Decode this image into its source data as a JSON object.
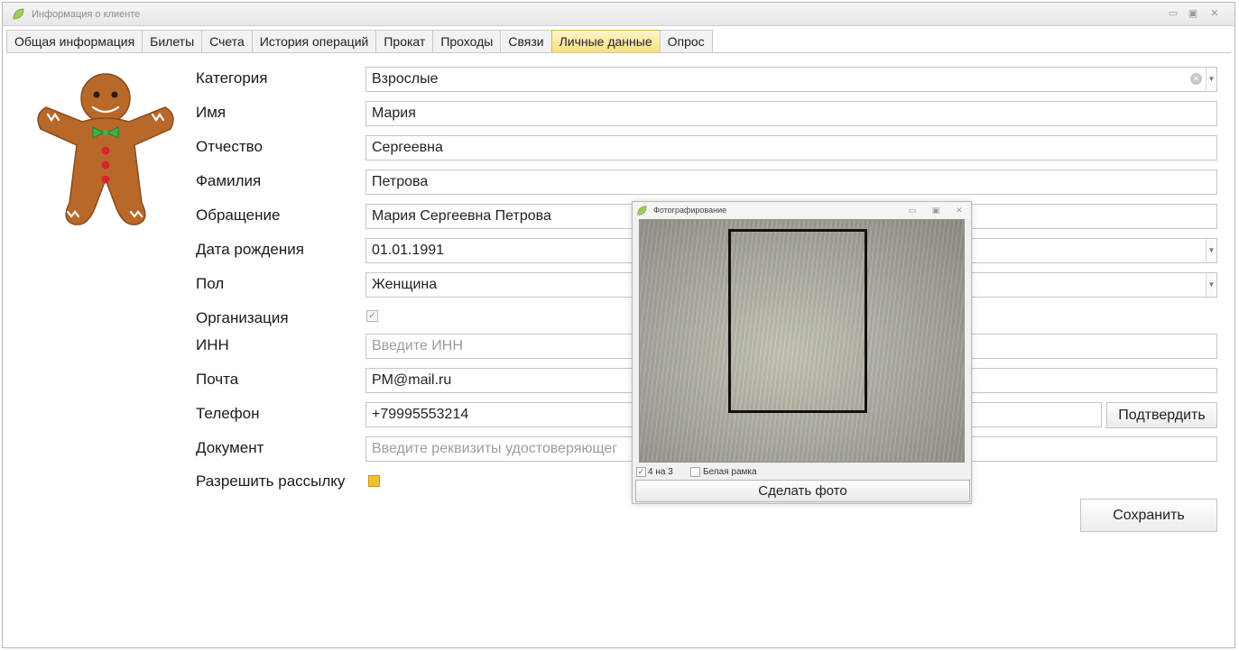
{
  "window": {
    "title": "Информация о клиенте"
  },
  "tabs": [
    {
      "label": "Общая информация"
    },
    {
      "label": "Билеты"
    },
    {
      "label": "Счета"
    },
    {
      "label": "История операций"
    },
    {
      "label": "Прокат"
    },
    {
      "label": "Проходы"
    },
    {
      "label": "Связи"
    },
    {
      "label": "Личные данные",
      "active": true
    },
    {
      "label": "Опрос"
    }
  ],
  "form": {
    "category": {
      "label": "Категория",
      "value": "Взрослые"
    },
    "first_name": {
      "label": "Имя",
      "value": "Мария"
    },
    "patronymic": {
      "label": "Отчество",
      "value": "Сергеевна"
    },
    "last_name": {
      "label": "Фамилия",
      "value": "Петрова"
    },
    "address": {
      "label": "Обращение",
      "value": "Мария Сергеевна Петрова"
    },
    "birth_date": {
      "label": "Дата рождения",
      "value": "01.01.1991"
    },
    "gender": {
      "label": "Пол",
      "value": "Женщина"
    },
    "organization": {
      "label": "Организация",
      "checked": true
    },
    "inn": {
      "label": "ИНН",
      "placeholder": "Введите ИНН"
    },
    "email": {
      "label": "Почта",
      "value": "PM@mail.ru"
    },
    "phone": {
      "label": "Телефон",
      "value": "+79995553214",
      "confirm_label": "Подтвердить"
    },
    "document": {
      "label": "Документ",
      "placeholder": "Введите реквизиты удостоверяющег"
    },
    "mailing": {
      "label": "Разрешить рассылку",
      "checked": true
    },
    "save_label": "Сохранить"
  },
  "camera": {
    "title": "Фотографирование",
    "option_4x3": {
      "label": "4 на 3",
      "checked": true
    },
    "option_white_frame": {
      "label": "Белая рамка",
      "checked": false
    },
    "take_photo_label": "Сделать фото"
  },
  "colors": {
    "active_tab": "#f8df7f",
    "mailing_checkbox": "#f1c232"
  },
  "icons": {
    "app": "leaf-icon",
    "avatar": "gingerbread-man-avatar"
  }
}
